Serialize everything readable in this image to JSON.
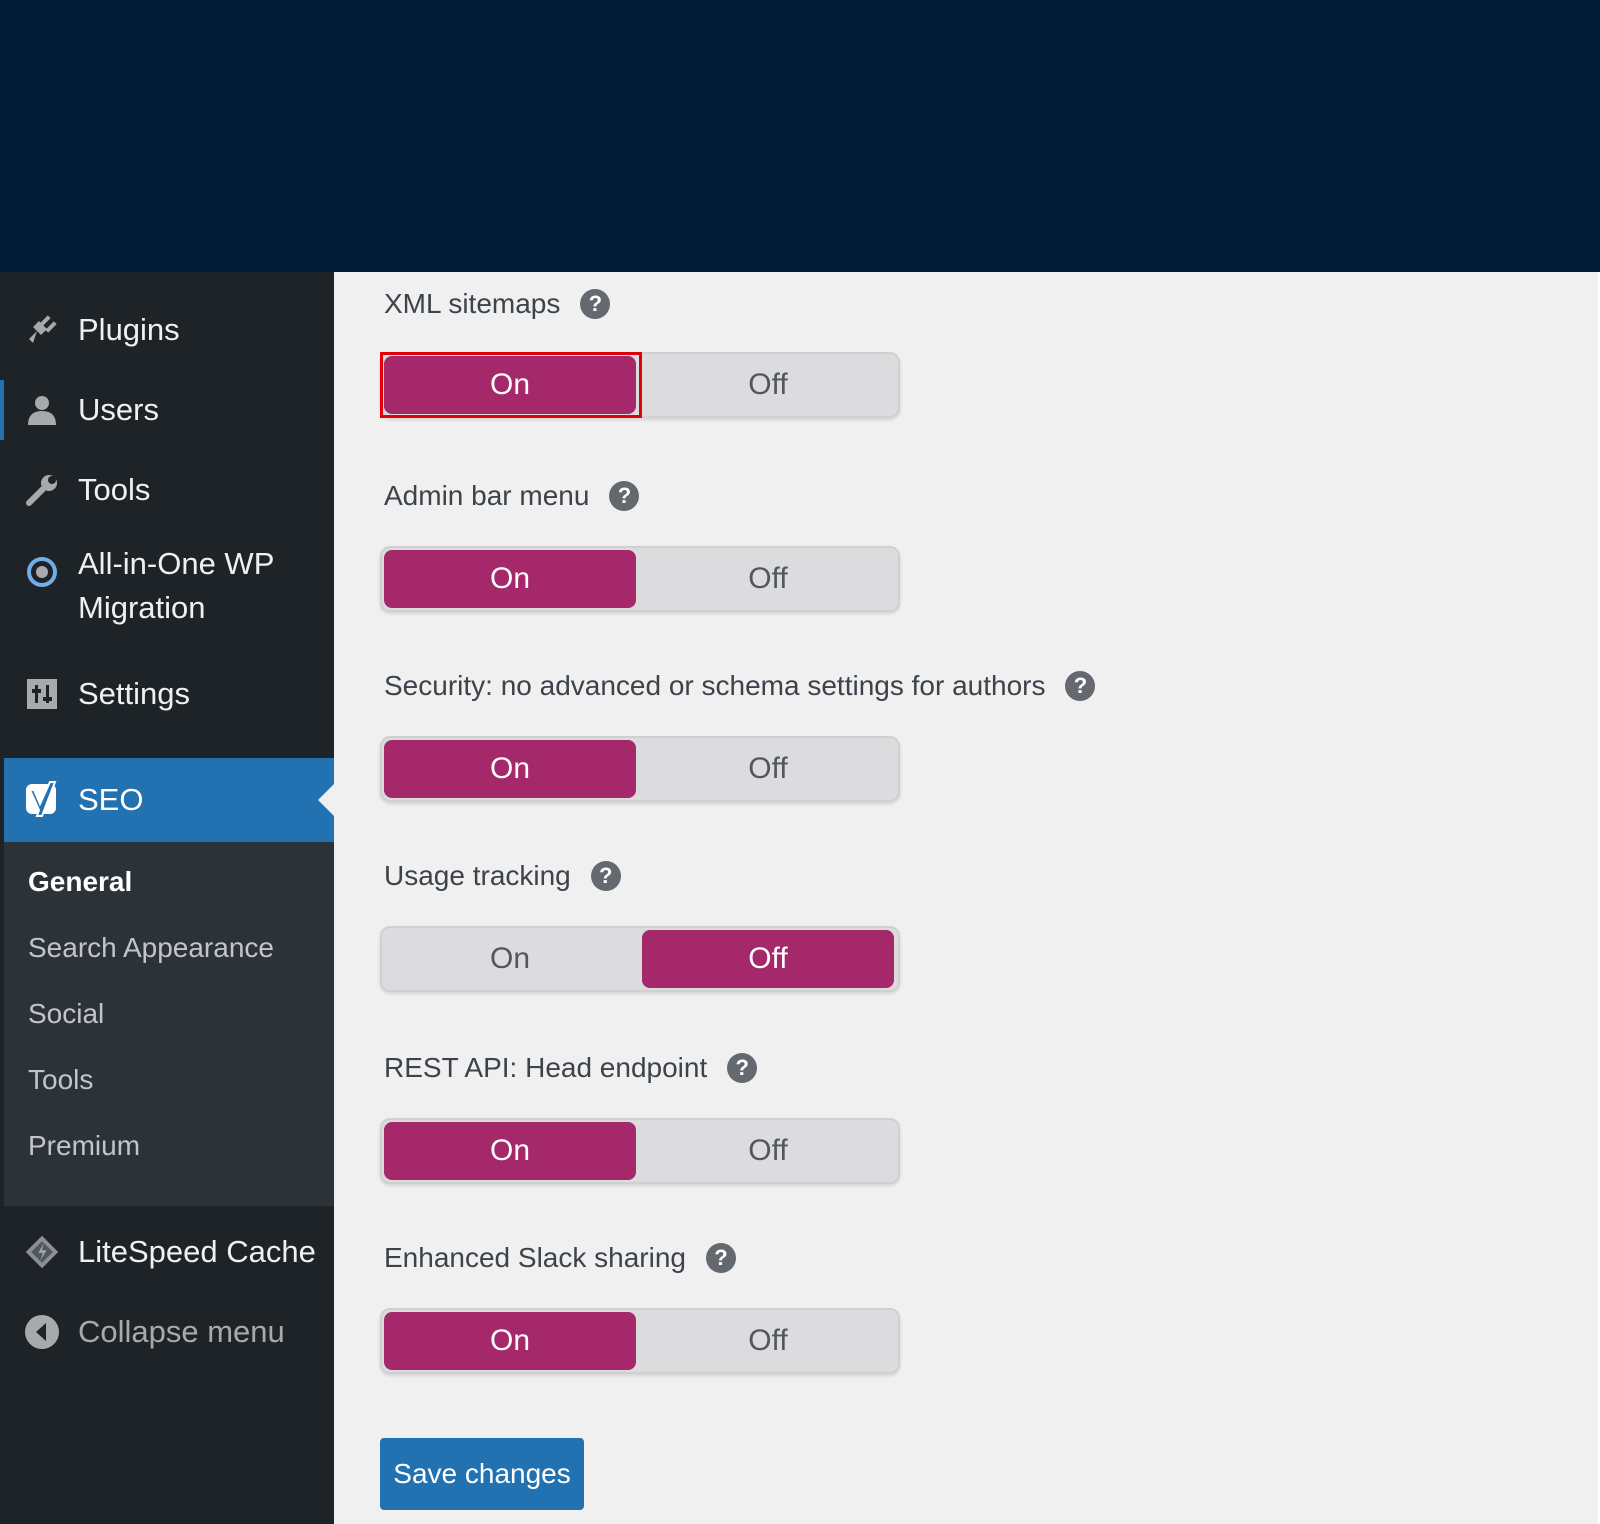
{
  "sidebar": {
    "items": [
      {
        "label": "Plugins",
        "icon": "plugins-icon"
      },
      {
        "label": "Users",
        "icon": "users-icon"
      },
      {
        "label": "Tools",
        "icon": "wrench-icon"
      },
      {
        "label": "All-in-One WP",
        "label2": "Migration",
        "icon": "migration-icon"
      },
      {
        "label": "Settings",
        "icon": "settings-icon"
      }
    ],
    "seo": {
      "label": "SEO",
      "icon": "yoast-icon"
    },
    "submenu": [
      "General",
      "Search Appearance",
      "Social",
      "Tools",
      "Premium"
    ],
    "litespeed": {
      "label": "LiteSpeed Cache",
      "icon": "litespeed-icon"
    },
    "collapse": {
      "label": "Collapse menu",
      "icon": "collapse-icon"
    }
  },
  "settings": [
    {
      "title": "XML sitemaps",
      "on": "On",
      "off": "Off",
      "selected": "on"
    },
    {
      "title": "Admin bar menu",
      "on": "On",
      "off": "Off",
      "selected": "on"
    },
    {
      "title": "Security: no advanced or schema settings for authors",
      "on": "On",
      "off": "Off",
      "selected": "on"
    },
    {
      "title": "Usage tracking",
      "on": "On",
      "off": "Off",
      "selected": "off"
    },
    {
      "title": "REST API: Head endpoint",
      "on": "On",
      "off": "Off",
      "selected": "on"
    },
    {
      "title": "Enhanced Slack sharing",
      "on": "On",
      "off": "Off",
      "selected": "on"
    }
  ],
  "help_symbol": "?",
  "save_label": "Save changes",
  "colors": {
    "accent": "#a4286a",
    "primary": "#2271b1",
    "highlight": "#e0000b"
  }
}
